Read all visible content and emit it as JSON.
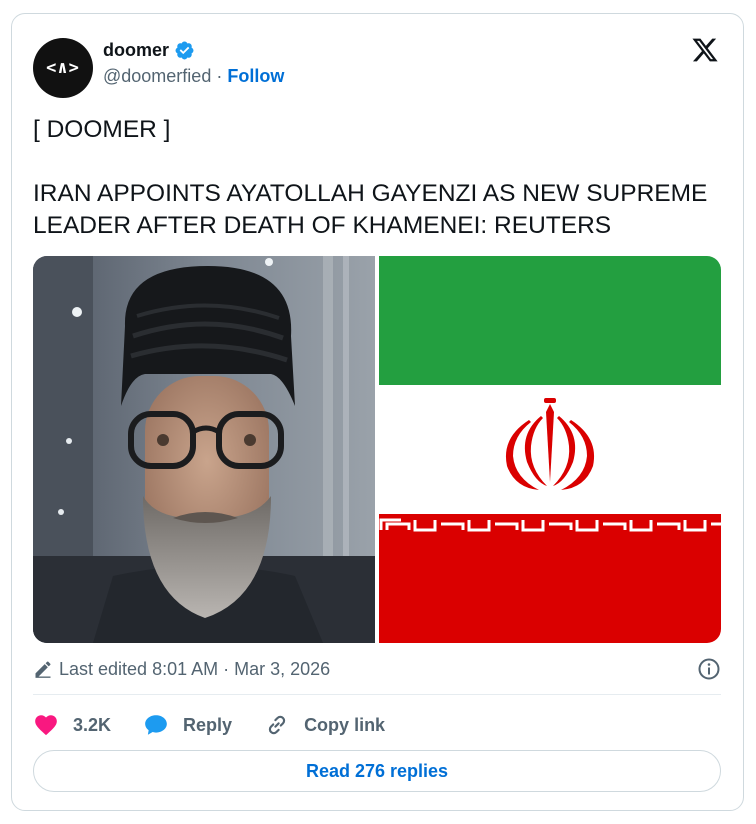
{
  "author": {
    "avatar_text": "<∧>",
    "display_name": "doomer",
    "handle": "@doomerfied",
    "separator": "·",
    "follow_label": "Follow"
  },
  "tweet": {
    "text": "[ DOOMER ]\n\nIRAN APPOINTS AYATOLLAH GAYENZI AS NEW SUPREME LEADER AFTER DEATH OF KHAMENEI: REUTERS"
  },
  "meta": {
    "edited_label": "Last edited 8:01 AM · Mar 3, 2026"
  },
  "actions": {
    "likes": "3.2K",
    "reply_label": "Reply",
    "copy_link_label": "Copy link"
  },
  "read_replies_label": "Read 276 replies",
  "colors": {
    "accent": "#006fd6",
    "verified": "#1d9bf0",
    "like": "#f91880",
    "flag_green": "#239f40",
    "flag_red": "#da0000"
  },
  "icons": [
    "verified-badge-icon",
    "x-logo-icon",
    "pencil-icon",
    "info-icon",
    "heart-icon",
    "reply-bubble-icon",
    "link-icon"
  ]
}
